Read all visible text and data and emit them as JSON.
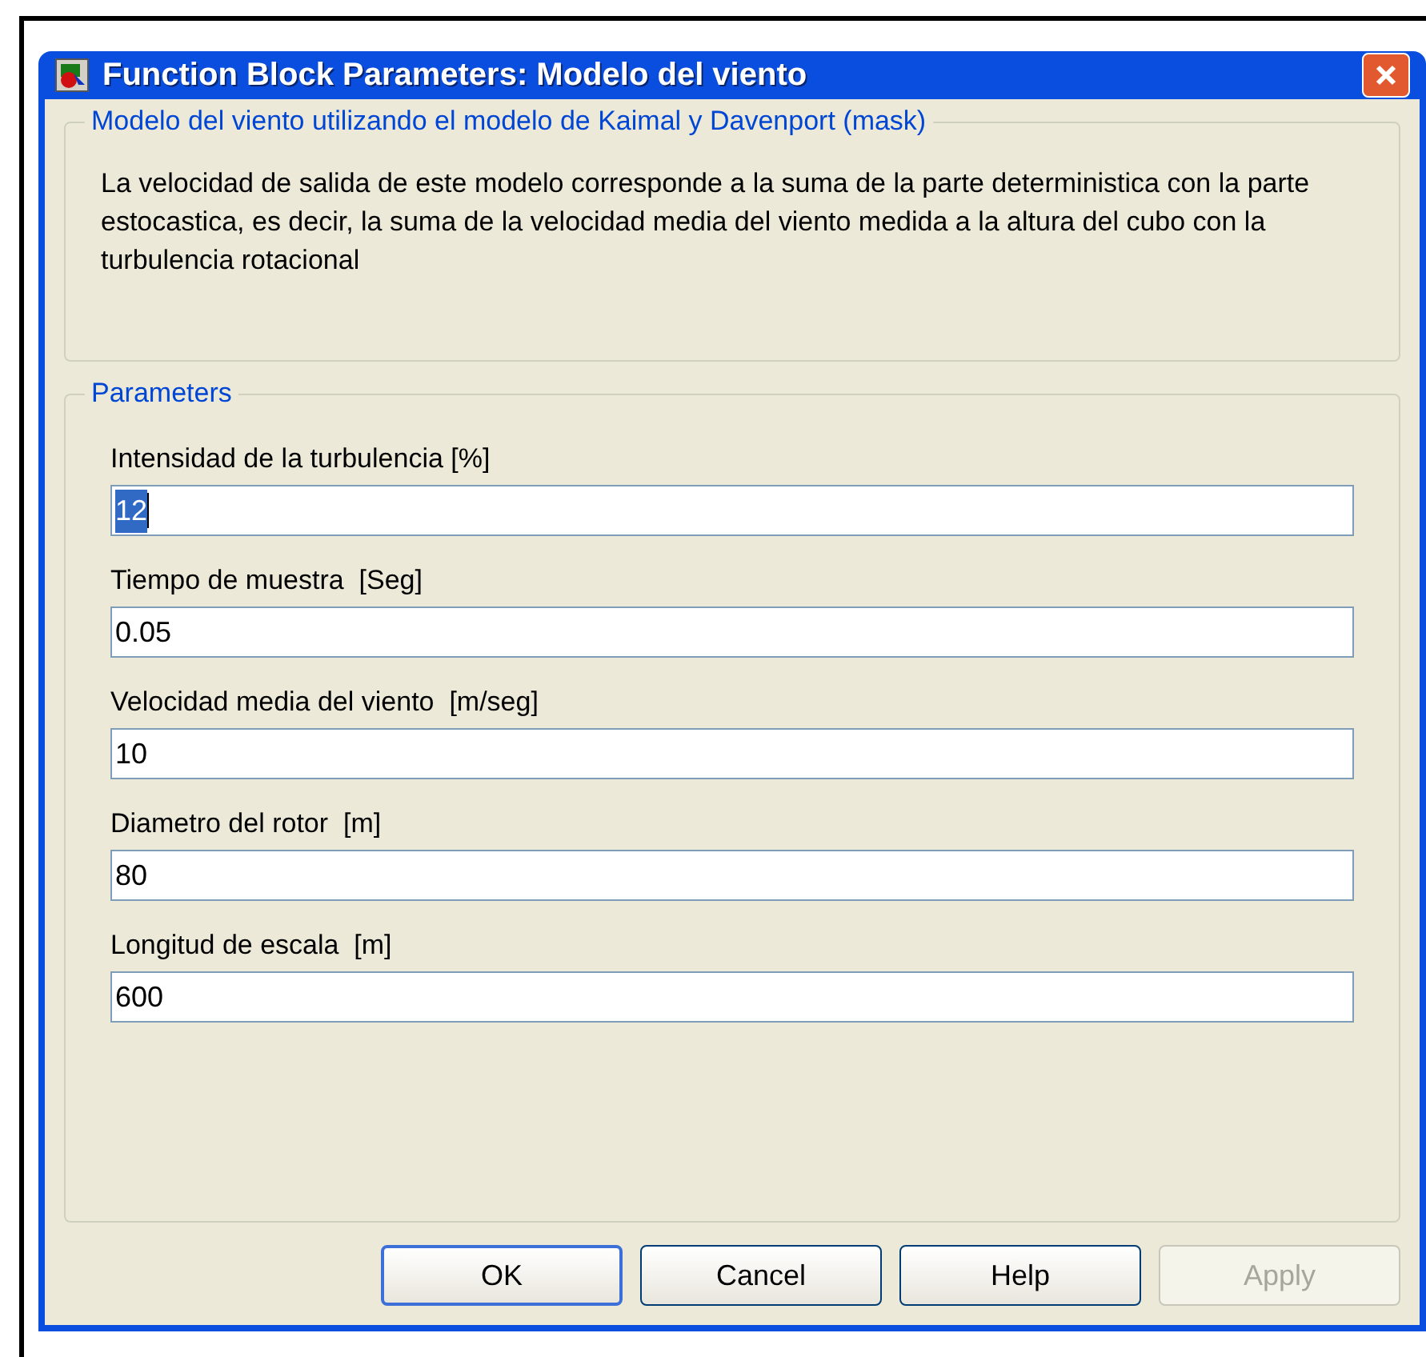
{
  "window": {
    "title": "Function Block Parameters: Modelo del viento"
  },
  "description": {
    "legend": "Modelo del viento utilizando el modelo de Kaimal y Davenport (mask)",
    "text": "La velocidad de salida de este modelo corresponde a la suma de la parte deterministica con la parte estocastica, es decir, la suma de la velocidad media del viento medida a la altura del cubo con la turbulencia rotacional"
  },
  "parameters": {
    "legend": "Parameters",
    "fields": [
      {
        "label": "Intensidad de la turbulencia [%]",
        "value": "12",
        "selected": true
      },
      {
        "label": "Tiempo de muestra  [Seg]",
        "value": "0.05",
        "selected": false
      },
      {
        "label": "Velocidad media del viento  [m/seg]",
        "value": "10",
        "selected": false
      },
      {
        "label": "Diametro del rotor  [m]",
        "value": "80",
        "selected": false
      },
      {
        "label": "Longitud de escala  [m]",
        "value": "600",
        "selected": false
      }
    ]
  },
  "buttons": [
    {
      "label": "OK",
      "default": true,
      "disabled": false
    },
    {
      "label": "Cancel",
      "default": false,
      "disabled": false
    },
    {
      "label": "Help",
      "default": false,
      "disabled": false
    },
    {
      "label": "Apply",
      "default": false,
      "disabled": true
    }
  ]
}
